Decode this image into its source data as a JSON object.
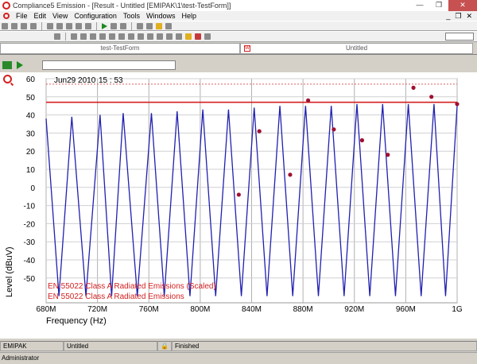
{
  "window": {
    "title": "Compliance5 Emission - [Result - Untitled [EMIPAK\\1\\test-TestForm]]"
  },
  "menu": {
    "items": [
      "File",
      "Edit",
      "View",
      "Configuration",
      "Tools",
      "Windows",
      "Help"
    ]
  },
  "tabs": [
    {
      "label": "test-TestForm"
    },
    {
      "label": "Untitled"
    }
  ],
  "graph": {
    "timestamp": {
      "y_top_label": "60",
      "date": "Jun29 2010",
      "time": "15 : 53"
    },
    "legend": [
      {
        "label": "EN 55022 Class A Radiated Emissions (Scaled)",
        "color": "#d42020"
      },
      {
        "label": "EN 55022 Class A Radiated Emissions",
        "color": "#d42020"
      }
    ]
  },
  "chart_data": {
    "type": "line",
    "title": "",
    "xlabel": "Frequency (Hz)",
    "ylabel": "Level (dBuV)",
    "xlim": [
      680,
      1000
    ],
    "ylim": [
      -60,
      60
    ],
    "x_unit": "MHz",
    "x_ticks": [
      680,
      720,
      760,
      800,
      840,
      880,
      920,
      960,
      1000
    ],
    "x_tick_labels": [
      "680M",
      "720M",
      "760M",
      "800M",
      "840M",
      "880M",
      "920M",
      "960M",
      "1G"
    ],
    "y_ticks": [
      -50,
      -40,
      -30,
      -20,
      -10,
      0,
      10,
      20,
      30,
      40,
      50,
      60
    ],
    "y_tick_labels": [
      "-50",
      "-40",
      "-30",
      "-20",
      "-10",
      "0",
      "10",
      "20",
      "30",
      "40",
      "50",
      "60"
    ],
    "grid": true,
    "spectrum": {
      "color": "#2020b0",
      "peaks_x": [
        680,
        700,
        722,
        740,
        762,
        782,
        802,
        822,
        842,
        862,
        882,
        902,
        922,
        942,
        962,
        982,
        1000
      ],
      "peak_y": [
        38,
        39,
        40,
        41,
        41,
        42,
        43,
        43,
        44,
        45,
        45,
        45,
        46,
        46,
        46,
        46,
        45
      ],
      "trough_y": -60
    },
    "limits": [
      {
        "name": "EN 55022 Class A Radiated Emissions (Scaled)",
        "y": 57,
        "style": "dotted",
        "color": "#e06060"
      },
      {
        "name": "EN 55022 Class A Radiated Emissions",
        "y": 47,
        "style": "solid",
        "color": "#d42020"
      }
    ],
    "markers": {
      "color": "#a01030",
      "points": [
        {
          "x": 830,
          "y": -4
        },
        {
          "x": 846,
          "y": 31
        },
        {
          "x": 870,
          "y": 7
        },
        {
          "x": 884,
          "y": 48
        },
        {
          "x": 904,
          "y": 32
        },
        {
          "x": 926,
          "y": 26
        },
        {
          "x": 946,
          "y": 18
        },
        {
          "x": 966,
          "y": 55
        },
        {
          "x": 980,
          "y": 50
        },
        {
          "x": 1000,
          "y": 46
        }
      ]
    }
  },
  "status": {
    "cell1": "EMIPAK",
    "cell2": "Untitled",
    "lock_icon": "lock-icon",
    "cell4": "Finished"
  },
  "bottom": {
    "user": "Administrator"
  }
}
